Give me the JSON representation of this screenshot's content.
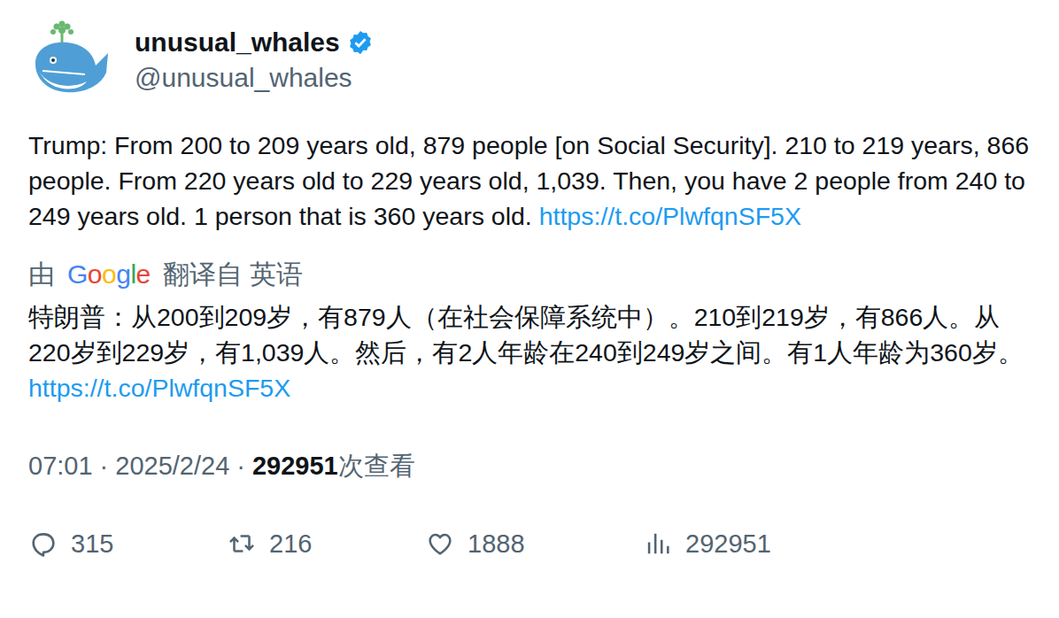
{
  "author": {
    "name": "unusual_whales",
    "handle": "@unusual_whales",
    "verified": true
  },
  "tweet": {
    "text": "Trump: From 200 to 209 years old, 879 people [on Social Security]. 210 to 219 years, 866 people. From 220 years old to 229 years old, 1,039. Then, you have 2 people from 240 to 249 years old. 1 person that is 360 years old.",
    "link": "https://t.co/PlwfqnSF5X"
  },
  "translation": {
    "by": "由",
    "brand": "Google",
    "label": "翻译自 英语",
    "text": "特朗普：从200到209岁，有879人（在社会保障系统中）。210到219岁，有866人。从220岁到229岁，有1,039人。然后，有2人年龄在240到249岁之间。有1人年龄为360岁。",
    "link": "https://t.co/PlwfqnSF5X"
  },
  "meta": {
    "time": "07:01",
    "separator": "·",
    "date": "2025/2/24",
    "views": "292951",
    "views_label": "次查看"
  },
  "actions": [
    {
      "kind": "reply",
      "count": "315"
    },
    {
      "kind": "retweet",
      "count": "216"
    },
    {
      "kind": "like",
      "count": "1888"
    },
    {
      "kind": "views",
      "count": "292951"
    }
  ]
}
